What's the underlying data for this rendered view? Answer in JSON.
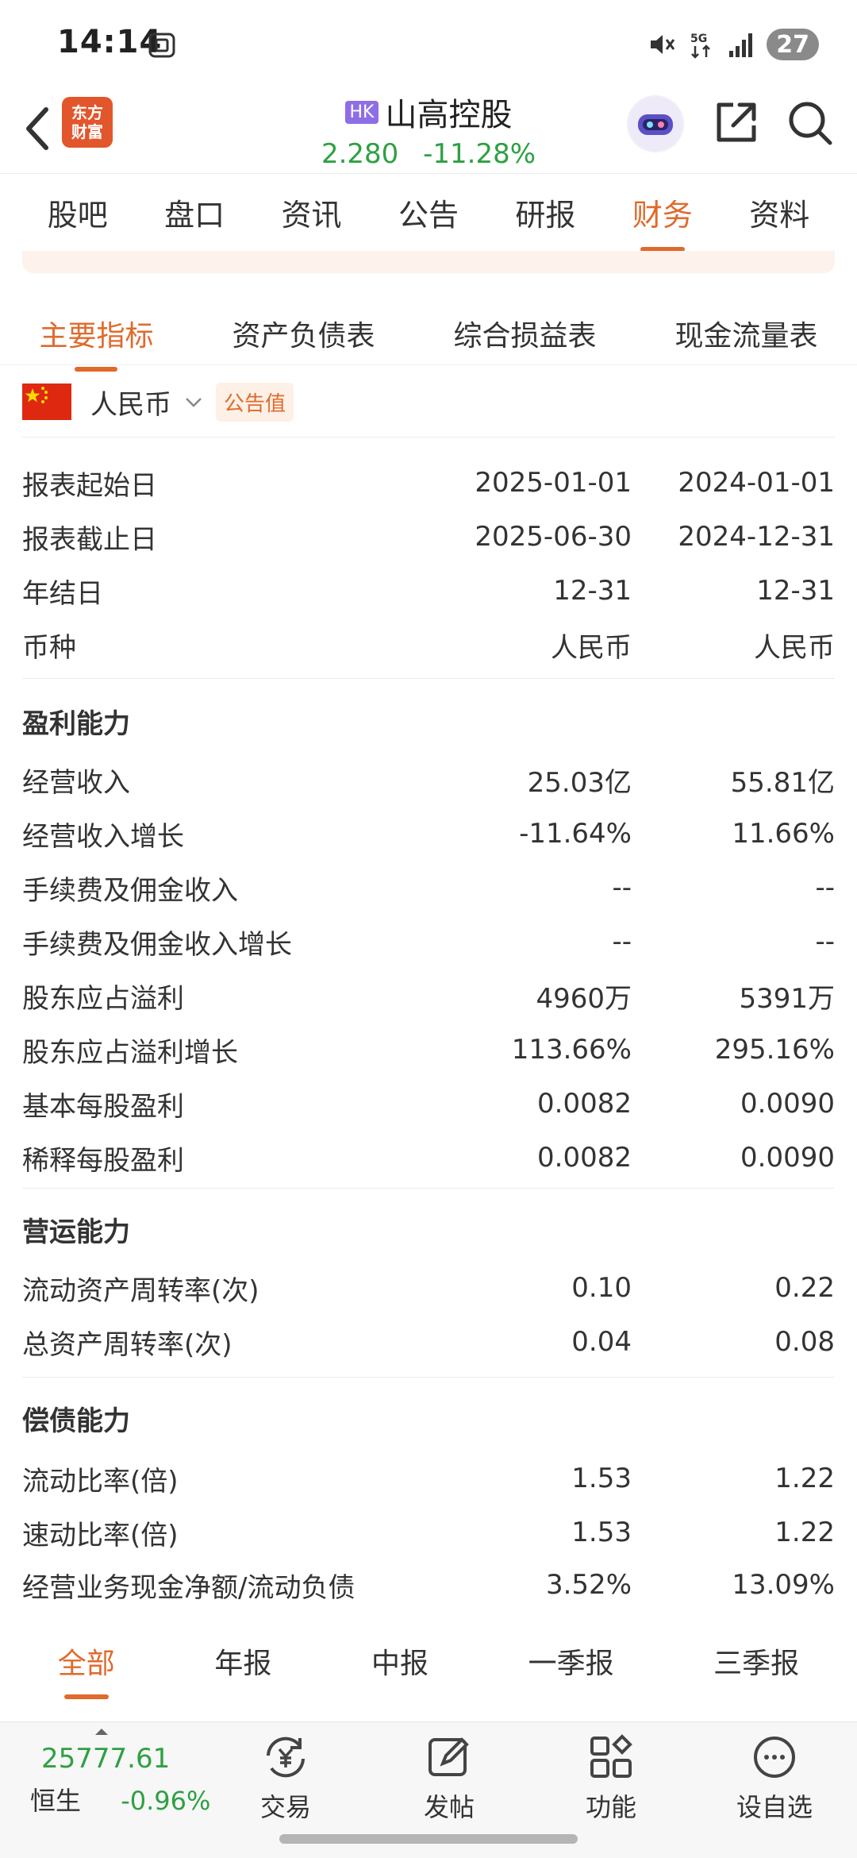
{
  "status_bar": {
    "time": "14:14",
    "network": "5G",
    "battery": "27"
  },
  "header": {
    "logo_line1": "东方",
    "logo_line2": "财富",
    "market_badge": "HK",
    "stock_name": "山高控股",
    "price": "2.280",
    "change_pct": "-11.28%"
  },
  "main_tabs": [
    "股吧",
    "盘口",
    "资讯",
    "公告",
    "研报",
    "财务",
    "资料"
  ],
  "main_tabs_active": "财务",
  "sub_tabs": [
    "主要指标",
    "资产负债表",
    "综合损益表",
    "现金流量表"
  ],
  "sub_tabs_active": "主要指标",
  "currency": {
    "label": "人民币",
    "badge": "公告值"
  },
  "basic_rows": [
    {
      "label": "报表起始日",
      "v1": "2025-01-01",
      "v2": "2024-01-01"
    },
    {
      "label": "报表截止日",
      "v1": "2025-06-30",
      "v2": "2024-12-31"
    },
    {
      "label": "年结日",
      "v1": "12-31",
      "v2": "12-31"
    },
    {
      "label": "币种",
      "v1": "人民币",
      "v2": "人民币"
    }
  ],
  "sections": [
    {
      "title": "盈利能力",
      "rows": [
        {
          "label": "经营收入",
          "v1": "25.03亿",
          "v2": "55.81亿"
        },
        {
          "label": "经营收入增长",
          "v1": "-11.64%",
          "v2": "11.66%"
        },
        {
          "label": "手续费及佣金收入",
          "v1": "--",
          "v2": "--"
        },
        {
          "label": "手续费及佣金收入增长",
          "v1": "--",
          "v2": "--"
        },
        {
          "label": "股东应占溢利",
          "v1": "4960万",
          "v2": "5391万"
        },
        {
          "label": "股东应占溢利增长",
          "v1": "113.66%",
          "v2": "295.16%"
        },
        {
          "label": "基本每股盈利",
          "v1": "0.0082",
          "v2": "0.0090"
        },
        {
          "label": "稀释每股盈利",
          "v1": "0.0082",
          "v2": "0.0090"
        }
      ]
    },
    {
      "title": "营运能力",
      "rows": [
        {
          "label": "流动资产周转率(次)",
          "v1": "0.10",
          "v2": "0.22"
        },
        {
          "label": "总资产周转率(次)",
          "v1": "0.04",
          "v2": "0.08"
        }
      ]
    },
    {
      "title": "偿债能力",
      "rows": [
        {
          "label": "流动比率(倍)",
          "v1": "1.53",
          "v2": "1.22"
        },
        {
          "label": "速动比率(倍)",
          "v1": "1.53",
          "v2": "1.22"
        },
        {
          "label": "经营业务现金净额/流动负债",
          "v1": "3.52%",
          "v2": "13.09%"
        }
      ]
    }
  ],
  "period_tabs": [
    "全部",
    "年报",
    "中报",
    "一季报",
    "三季报"
  ],
  "period_tabs_active": "全部",
  "bottom_bar": {
    "index_value": "25777.61",
    "index_name": "恒生",
    "index_change": "-0.96%",
    "nav": [
      "交易",
      "发帖",
      "功能",
      "设自选"
    ]
  },
  "colors": {
    "accent": "#e06a2c",
    "down_green": "#2ea043",
    "hk_badge": "#8e6ee6"
  }
}
